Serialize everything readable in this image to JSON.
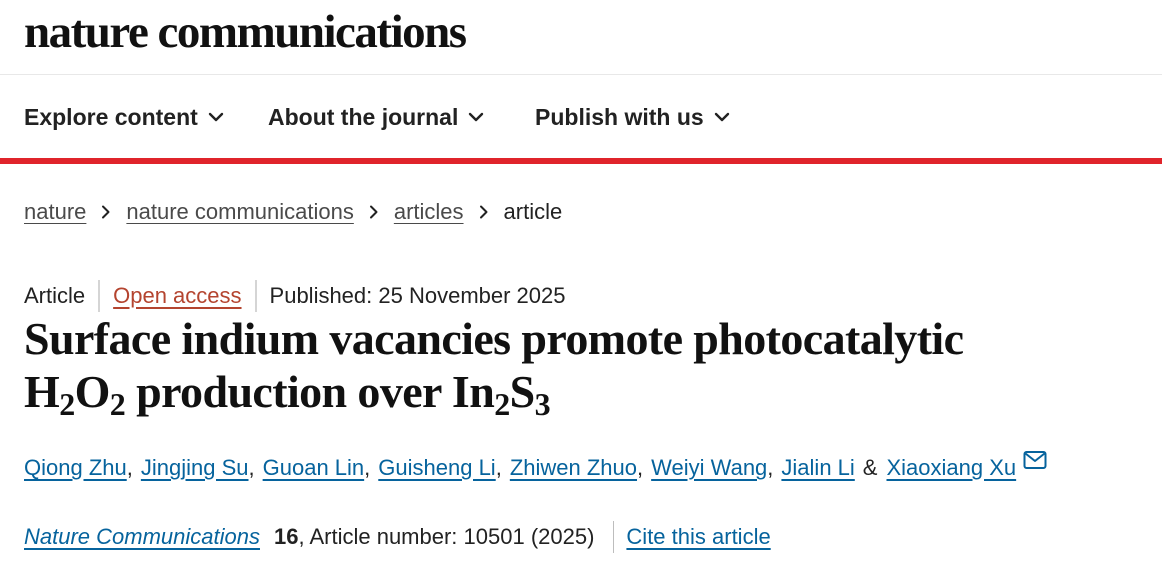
{
  "header": {
    "logo": "nature communications"
  },
  "nav": {
    "items": [
      {
        "label": "Explore content"
      },
      {
        "label": "About the journal"
      },
      {
        "label": "Publish with us"
      }
    ]
  },
  "breadcrumb": {
    "items": [
      "nature",
      "nature communications",
      "articles"
    ],
    "current": "article"
  },
  "meta": {
    "type": "Article",
    "access": "Open access",
    "published": "Published: 25 November 2025"
  },
  "title": {
    "line1": "Surface indium vacancies promote photocatalytic",
    "h": "H",
    "sub1": "2",
    "o": "O",
    "sub2": "2",
    "mid": " production over In",
    "sub3": "2",
    "s": "S",
    "sub4": "3"
  },
  "authors": {
    "list": [
      "Qiong Zhu",
      "Jingjing Su",
      "Guoan Lin",
      "Guisheng Li",
      "Zhiwen Zhuo",
      "Weiyi Wang",
      "Jialin Li",
      "Xiaoxiang Xu"
    ],
    "separator": ",",
    "and": "&"
  },
  "citation": {
    "journal": "Nature Communications",
    "volume": "16",
    "article_number": ", Article number: 10501 (2025)",
    "cite_label": "Cite this article"
  },
  "colors": {
    "accent_red": "#e0242b",
    "link_blue": "#06639d",
    "open_access": "#b4442f"
  }
}
